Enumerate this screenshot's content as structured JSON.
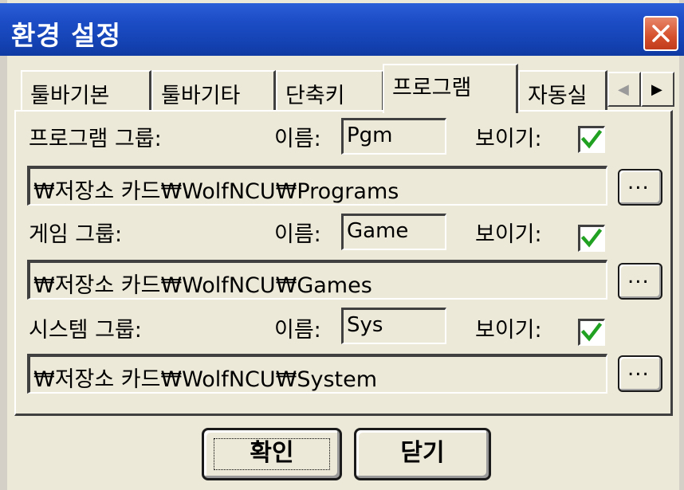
{
  "window": {
    "title": "환경 설정"
  },
  "tabs": [
    {
      "label": "툴바기본"
    },
    {
      "label": "툴바기타"
    },
    {
      "label": "단축키"
    },
    {
      "label": "프로그램"
    },
    {
      "label": "자동실"
    }
  ],
  "tab_scroll": {
    "left": "◀",
    "right": "▶"
  },
  "groups": [
    {
      "label": "프로그램 그룹:",
      "name_label": "이름:",
      "name_value": "Pgm",
      "show_label": "보이기:",
      "show_checked": true,
      "path": "₩저장소 카드₩WolfNCU₩Programs",
      "browse_label": "..."
    },
    {
      "label": "게임 그룹:",
      "name_label": "이름:",
      "name_value": "Game",
      "show_label": "보이기:",
      "show_checked": true,
      "path": "₩저장소 카드₩WolfNCU₩Games",
      "browse_label": "..."
    },
    {
      "label": "시스템 그룹:",
      "name_label": "이름:",
      "name_value": "Sys",
      "show_label": "보이기:",
      "show_checked": true,
      "path": "₩저장소 카드₩WolfNCU₩System",
      "browse_label": "..."
    }
  ],
  "buttons": {
    "ok": "확인",
    "close": "닫기"
  },
  "colors": {
    "titlebar": "#1e4ec8",
    "close_button": "#d5502c",
    "checkmark": "#21a121",
    "dialog_bg": "#ece9d8"
  },
  "icons": {
    "close": "close-icon",
    "check": "check-icon"
  }
}
